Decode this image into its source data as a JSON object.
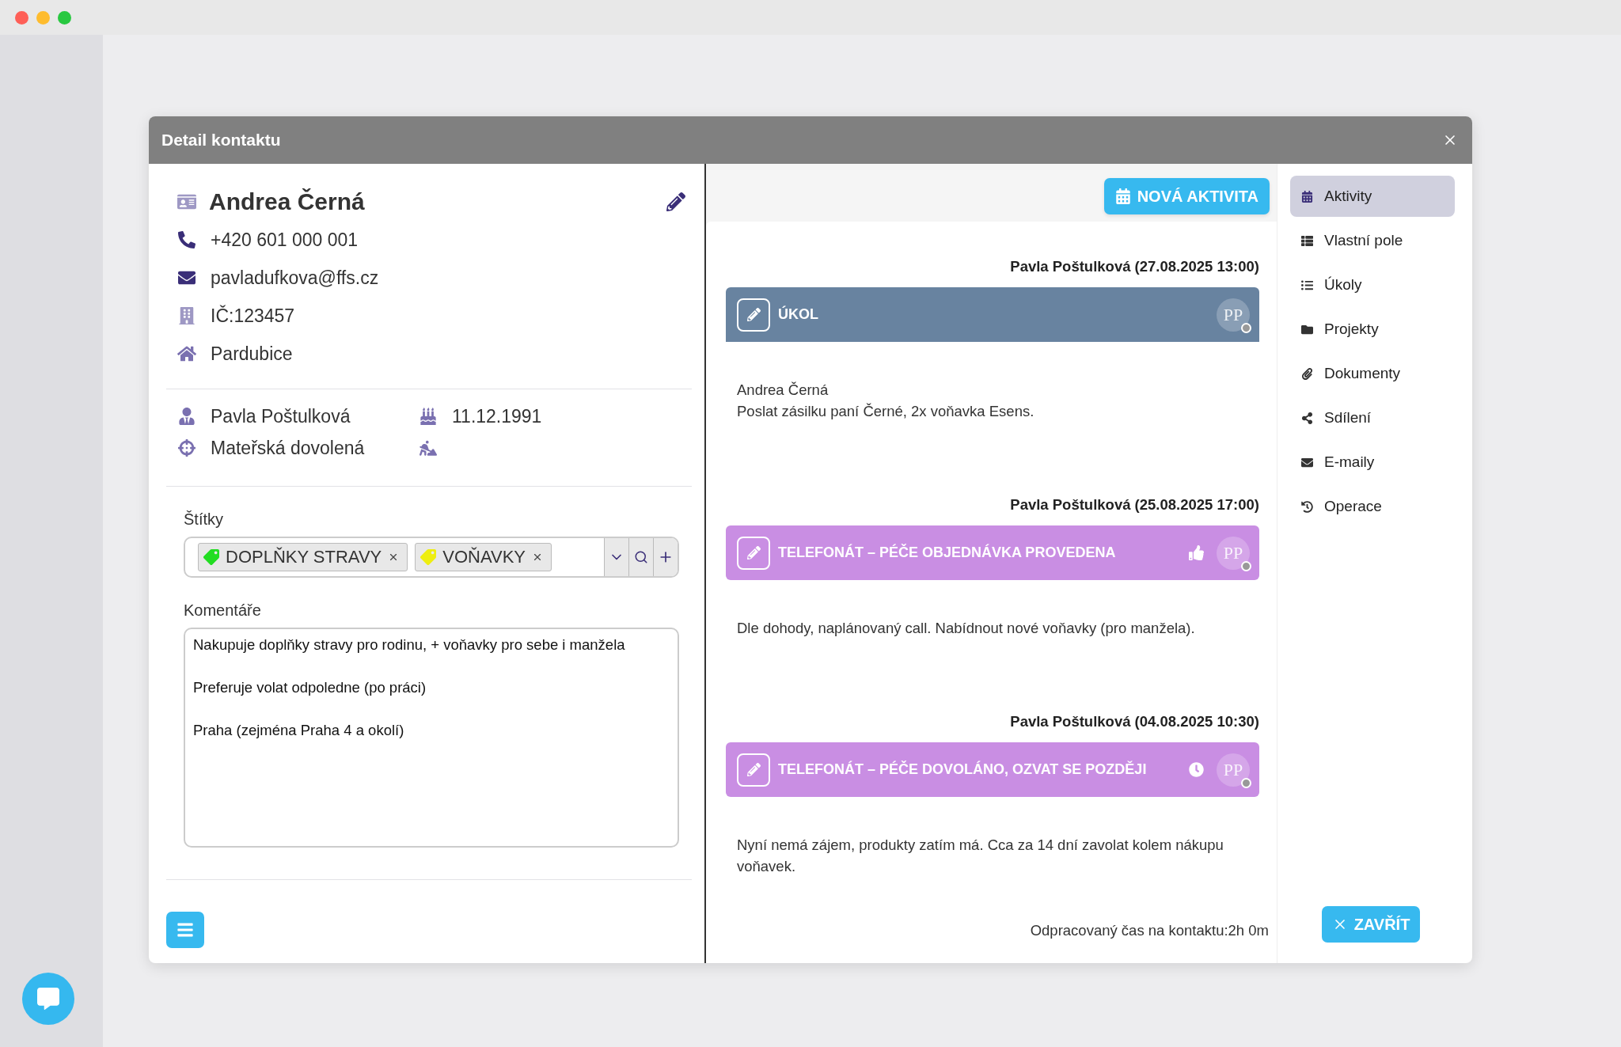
{
  "window": {
    "title": "Detail kontaktu"
  },
  "contact": {
    "name": "Andrea Černá",
    "phone": "+420 601 000 001",
    "email": "pavladufkova@ffs.cz",
    "ico": "IČ:123457",
    "city": "Pardubice",
    "owner": "Pavla Poštulková",
    "birthday": "11.12.1991",
    "status": "Mateřská dovolená"
  },
  "tags": {
    "label": "Štítky",
    "items": [
      {
        "label": "DOPLŇKY STRAVY",
        "color": "#22dd22"
      },
      {
        "label": "VOŇAVKY",
        "color": "#eeee11"
      }
    ]
  },
  "comments": {
    "label": "Komentáře",
    "value": "Nakupuje doplňky stravy pro rodinu, + voňavky pro sebe i manžela\n\nPreferuje volat odpoledne (po práci)\n\nPraha (zejména Praha 4 a okolí)"
  },
  "new_activity_button": "NOVÁ AKTIVITA",
  "activities": [
    {
      "author": "Pavla Poštulková (27.08.2025 13:00)",
      "kind": "task",
      "title": "ÚKOL",
      "avatar": "PP",
      "liked": false,
      "waiting": false,
      "lines": [
        "Andrea Černá",
        "Poslat zásilku paní Černé, 2x voňavka Esens."
      ]
    },
    {
      "author": "Pavla Poštulková (25.08.2025 17:00)",
      "kind": "call",
      "title": "TELEFONÁT – PÉČE OBJEDNÁVKA PROVEDENA",
      "avatar": "PP",
      "liked": true,
      "waiting": false,
      "lines": [
        "Dle dohody, naplánovaný call. Nabídnout nové voňavky (pro manžela)."
      ]
    },
    {
      "author": "Pavla Poštulková (04.08.2025 10:30)",
      "kind": "call",
      "title": "TELEFONÁT – PÉČE DOVOLÁNO, OZVAT SE POZDĚJI",
      "avatar": "PP",
      "liked": false,
      "waiting": true,
      "lines": [
        "Nyní nemá zájem, produkty zatím má. Cca za 14 dní zavolat kolem nákupu voňavek."
      ]
    }
  ],
  "worked_time": "Odpracovaný čas na kontaktu:2h 0m",
  "close_button": "ZAVŘÍT",
  "nav": [
    {
      "label": "Aktivity",
      "selected": true
    },
    {
      "label": "Vlastní pole",
      "selected": false
    },
    {
      "label": "Úkoly",
      "selected": false
    },
    {
      "label": "Projekty",
      "selected": false
    },
    {
      "label": "Dokumenty",
      "selected": false
    },
    {
      "label": "Sdílení",
      "selected": false
    },
    {
      "label": "E-maily",
      "selected": false
    },
    {
      "label": "Operace",
      "selected": false
    }
  ]
}
